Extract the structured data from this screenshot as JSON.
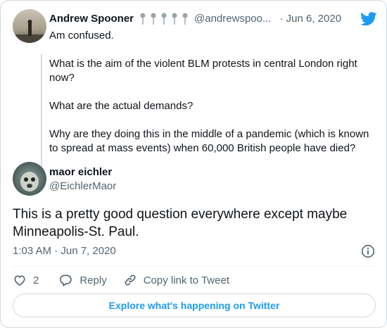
{
  "parent_tweet": {
    "name": "Andrew Spooner",
    "emoji_count": 5,
    "handle": "@andrewspoo...",
    "separator": "·",
    "date": "Jun 6, 2020",
    "paragraphs": [
      "Am confused.",
      "What is the aim of the violent BLM protests in central London right now?",
      "What are the actual demands?",
      "Why are they doing this in the middle of a pandemic (which is known to spread at mass events) when 60,000 British people have died?"
    ]
  },
  "tweet": {
    "name": "maor eichler",
    "handle": "@EichlerMaor",
    "text": "This is a pretty good question everywhere except maybe Minneapolis-St. Paul.",
    "timestamp": "1:03 AM · Jun 7, 2020"
  },
  "actions": {
    "like_count": "2",
    "reply_label": "Reply",
    "copy_label": "Copy link to Tweet"
  },
  "footer": {
    "explore_label": "Explore what's happening on Twitter"
  },
  "colors": {
    "accent": "#1d9bf0",
    "text": "#0f1419",
    "secondary": "#536471",
    "border": "#cfd9de"
  },
  "icons": [
    "twitter-bird-icon",
    "pin-icon",
    "info-icon",
    "heart-icon",
    "reply-icon",
    "link-icon"
  ]
}
